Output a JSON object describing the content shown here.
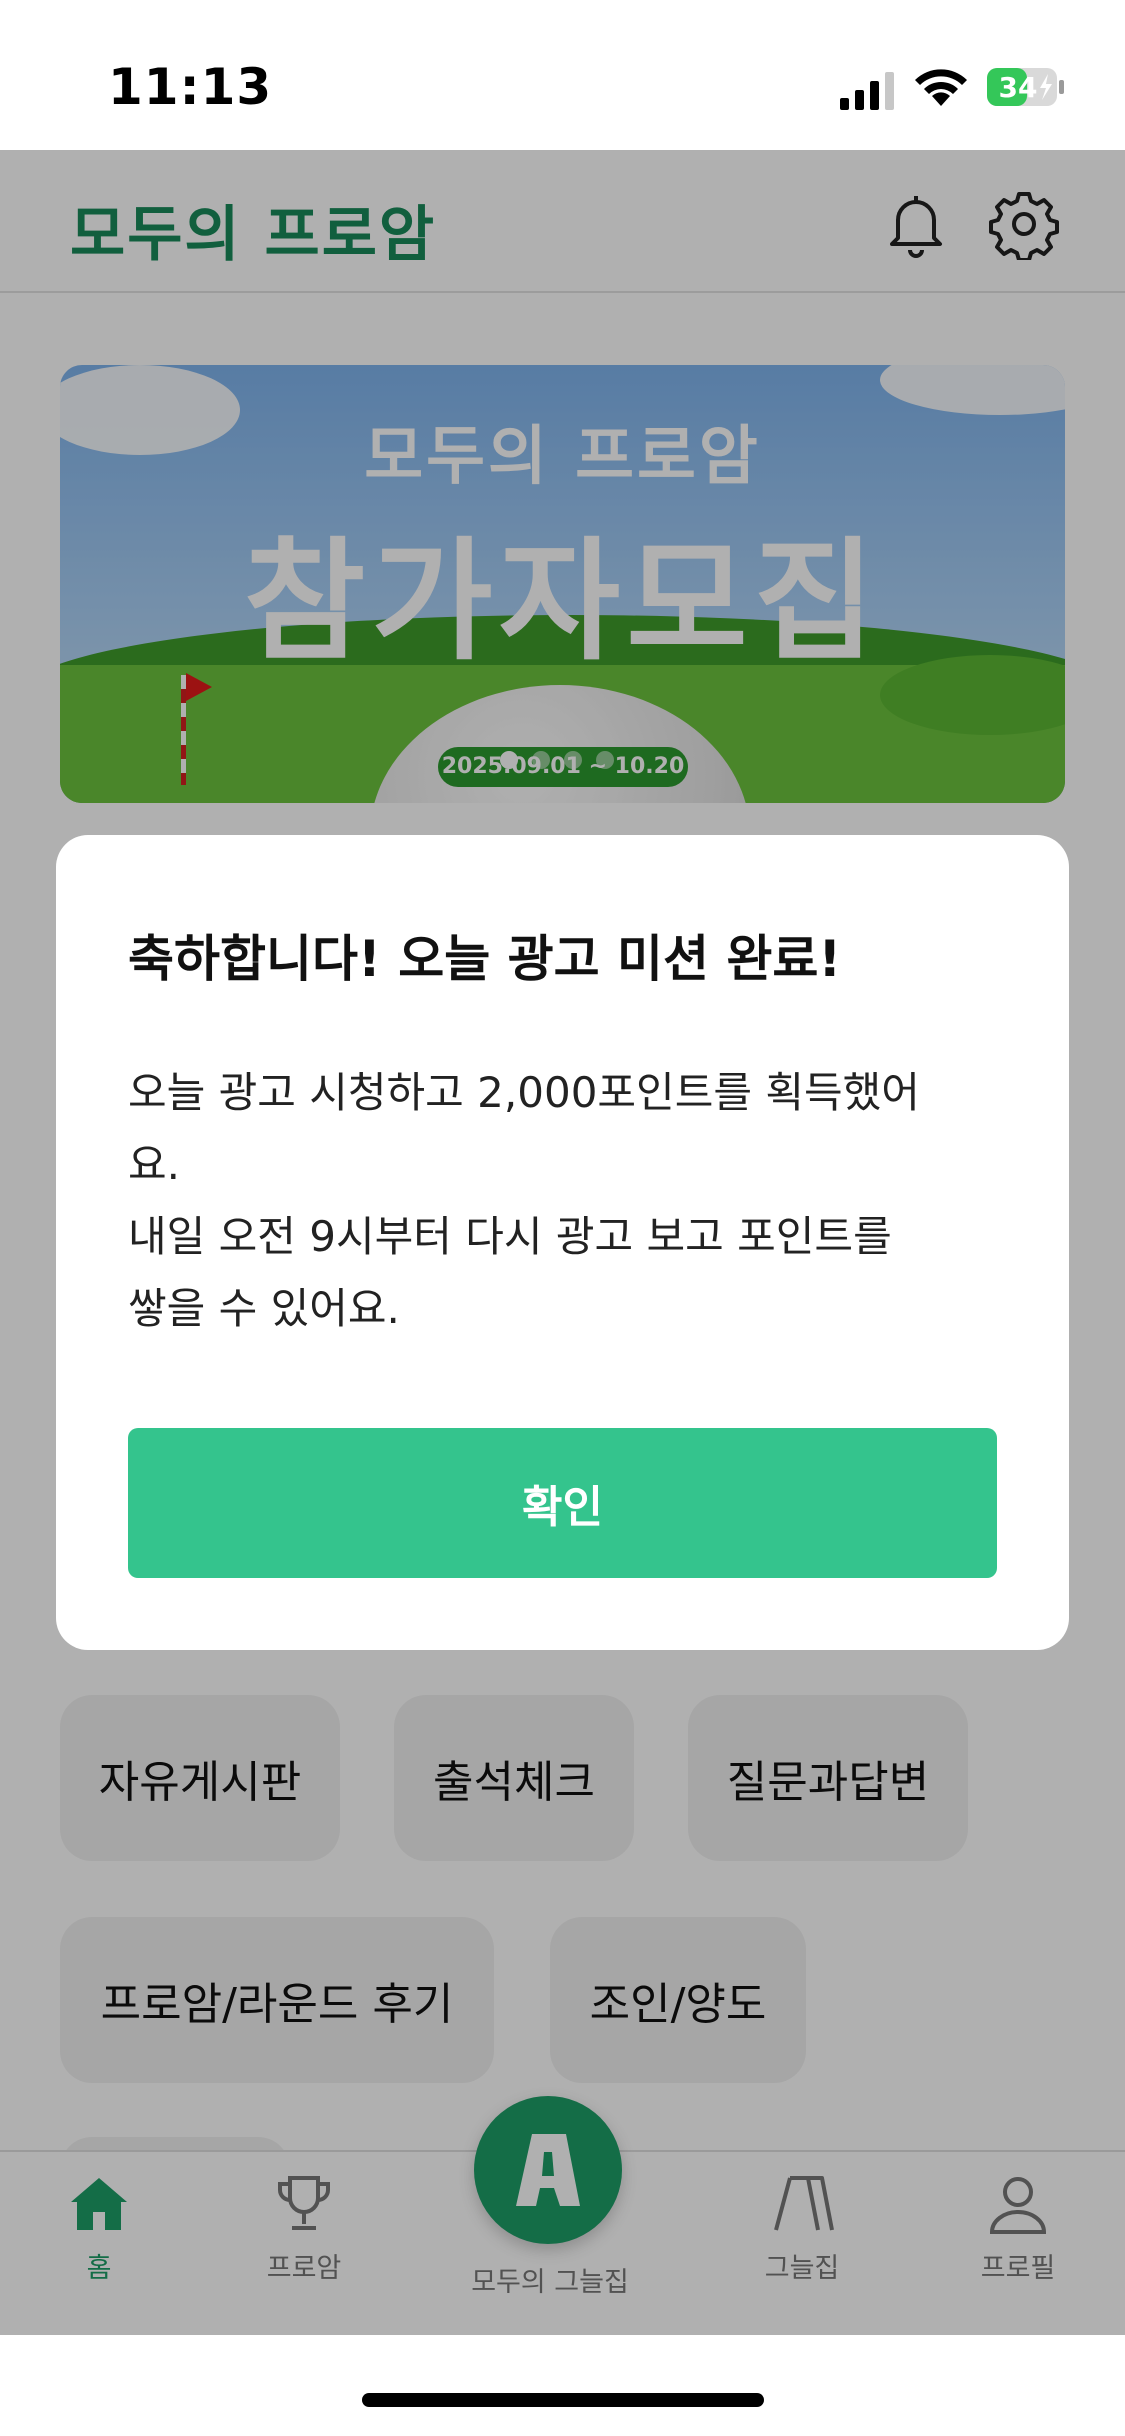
{
  "status_bar": {
    "time": "11:13",
    "battery": "34"
  },
  "header": {
    "logo": "모두의 프로암"
  },
  "banner": {
    "subtitle": "모두의 프로암",
    "title": "참가자모집",
    "date": "2025.09.01 ~ 10.20"
  },
  "chips": [
    "자유게시판",
    "출석체크",
    "질문과답변",
    "프로암/라운드 후기",
    "조인/양도"
  ],
  "dialog": {
    "title": "축하합니다! 오늘 광고 미션 완료!",
    "message_lines": [
      "오늘 광고 시청하고 2,000포인트를 획득했어",
      "요.",
      "내일 오전 9시부터 다시 광고 보고 포인트를",
      "쌓을 수 있어요."
    ],
    "confirm": "확인"
  },
  "nav": {
    "home": "홈",
    "proam": "프로암",
    "center": "모두의 그늘집",
    "shade": "그늘집",
    "profile": "프로필"
  },
  "colors": {
    "brand": "#1e9e67",
    "button": "#34c48d"
  }
}
